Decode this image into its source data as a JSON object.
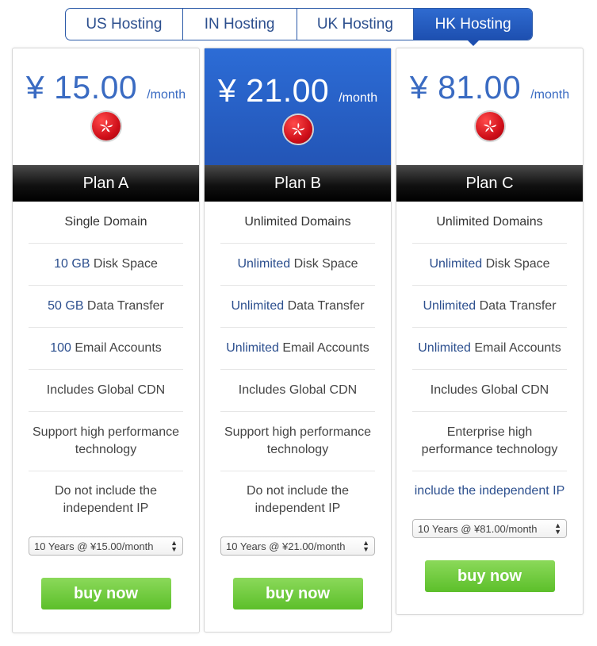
{
  "tabs": [
    {
      "label": "US Hosting"
    },
    {
      "label": "IN Hosting"
    },
    {
      "label": "UK Hosting"
    },
    {
      "label": "HK Hosting"
    }
  ],
  "active_tab": "HK Hosting",
  "plans": [
    {
      "price": "¥ 15.00",
      "period": "/month",
      "name": "Plan A",
      "features": [
        {
          "value": "",
          "text": "Single Domain"
        },
        {
          "value": "10 GB",
          "text": " Disk Space"
        },
        {
          "value": "50 GB",
          "text": " Data Transfer"
        },
        {
          "value": "100",
          "text": " Email Accounts"
        },
        {
          "value": "",
          "text": "Includes Global CDN"
        },
        {
          "value": "",
          "text": "Support high performance technology"
        },
        {
          "value": "",
          "text": "Do not include the independent IP"
        }
      ],
      "term": "10 Years @ ¥15.00/month",
      "buy_label": "buy now"
    },
    {
      "price": "¥ 21.00",
      "period": "/month",
      "name": "Plan B",
      "features": [
        {
          "value": "",
          "text": "Unlimited Domains"
        },
        {
          "value": "Unlimited",
          "text": " Disk Space"
        },
        {
          "value": "Unlimited",
          "text": " Data Transfer"
        },
        {
          "value": "Unlimited",
          "text": " Email Accounts"
        },
        {
          "value": "",
          "text": "Includes Global CDN"
        },
        {
          "value": "",
          "text": "Support high performance technology"
        },
        {
          "value": "",
          "text": "Do not include the independent IP"
        }
      ],
      "term": "10 Years @ ¥21.00/month",
      "buy_label": "buy now"
    },
    {
      "price": "¥ 81.00",
      "period": "/month",
      "name": "Plan C",
      "features": [
        {
          "value": "",
          "text": "Unlimited Domains"
        },
        {
          "value": "Unlimited",
          "text": " Disk Space"
        },
        {
          "value": "Unlimited",
          "text": " Data Transfer"
        },
        {
          "value": "Unlimited",
          "text": " Email Accounts"
        },
        {
          "value": "",
          "text": "Includes Global CDN"
        },
        {
          "value": "",
          "text": "Enterprise high performance technology"
        },
        {
          "value": "include the independent IP",
          "text": ""
        }
      ],
      "term": "10 Years @ ¥81.00/month",
      "buy_label": "buy now"
    }
  ],
  "colors": {
    "accent": "#2c4f8e",
    "active_tab": "#2355b6",
    "buy_button": "#6cc63a",
    "plan_header": "#111111"
  },
  "icons": {
    "flag": "hong-kong-flag-icon",
    "select_arrows": "updown-arrows-icon"
  }
}
